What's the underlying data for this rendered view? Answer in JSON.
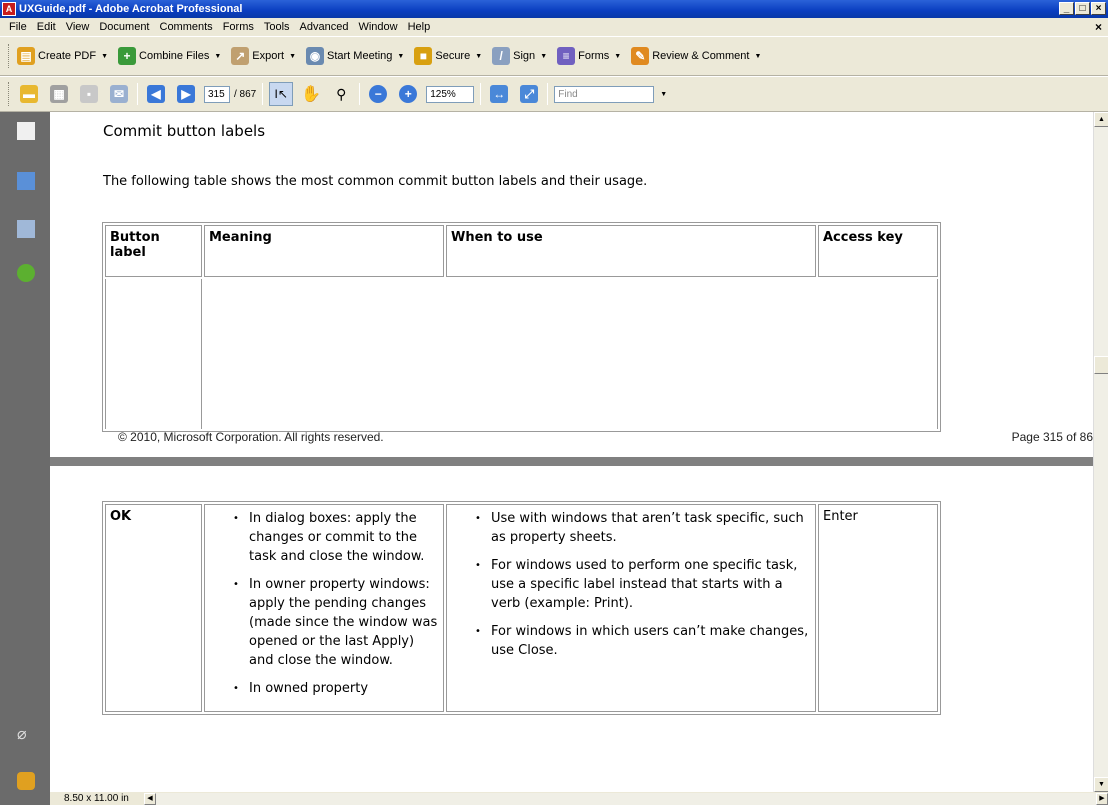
{
  "window": {
    "title": "UXGuide.pdf - Adobe Acrobat Professional",
    "app_icon": "pdf-icon",
    "minimize_label": "_",
    "maximize_label": "□",
    "close_label": "×",
    "doc_close_label": "×"
  },
  "menu": [
    "File",
    "Edit",
    "View",
    "Document",
    "Comments",
    "Forms",
    "Tools",
    "Advanced",
    "Window",
    "Help"
  ],
  "toolbar1": {
    "create_pdf": "Create PDF",
    "combine_files": "Combine Files",
    "export": "Export",
    "start_meeting": "Start Meeting",
    "secure": "Secure",
    "sign": "Sign",
    "forms": "Forms",
    "review_comment": "Review & Comment"
  },
  "toolbar2": {
    "page_current": "315",
    "page_total": "/ 867",
    "zoom": "125%",
    "find_placeholder": "Find"
  },
  "document": {
    "page1": {
      "heading": "Commit button labels",
      "intro": "The following table shows the most common commit button labels and their usage.",
      "table_headers": [
        "Button label",
        "Meaning",
        "When to use",
        "Access key"
      ],
      "footer_left": "© 2010, Microsoft Corporation. All rights reserved.",
      "footer_right": "Page 315 of 86"
    },
    "page2": {
      "row": {
        "label": "OK",
        "meaning": [
          "In dialog boxes: apply the changes or commit to the task and close the window.",
          "In owner property windows: apply the pending changes (made since the window was opened or the last Apply) and close the window.",
          "In owned property"
        ],
        "when_to_use": [
          "Use with windows that aren’t task specific, such as property sheets.",
          "For windows used to perform one specific task, use a specific label instead that starts with a verb (example: Print).",
          "For windows in which users can’t make changes, use Close."
        ],
        "access_key": "Enter"
      }
    }
  },
  "status": {
    "page_size": "8.50 x 11.00 in"
  },
  "colors": {
    "titlebar": "#0a3ec0",
    "chrome": "#ece9d8",
    "navpane": "#6b6b6b",
    "doc_background": "#808080"
  }
}
